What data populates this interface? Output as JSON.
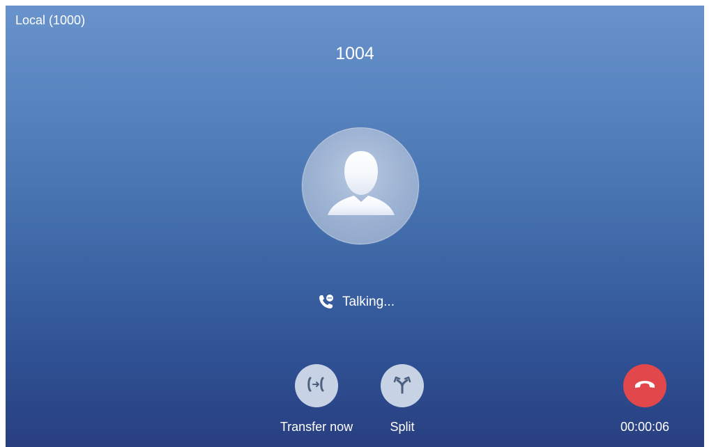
{
  "call": {
    "line_label": "Local (1000)",
    "callee_number": "1004",
    "status_text": "Talking...",
    "duration": "00:00:06"
  },
  "actions": {
    "transfer_label": "Transfer now",
    "split_label": "Split"
  },
  "icons": {
    "avatar": "contact-avatar-icon",
    "status": "phone-talking-icon",
    "transfer": "transfer-icon",
    "split": "split-icon",
    "hangup": "hangup-icon"
  },
  "colors": {
    "hangup": "#e2474b",
    "action_button": "#c7d2e5",
    "icon_gray": "#4c5f7f"
  }
}
